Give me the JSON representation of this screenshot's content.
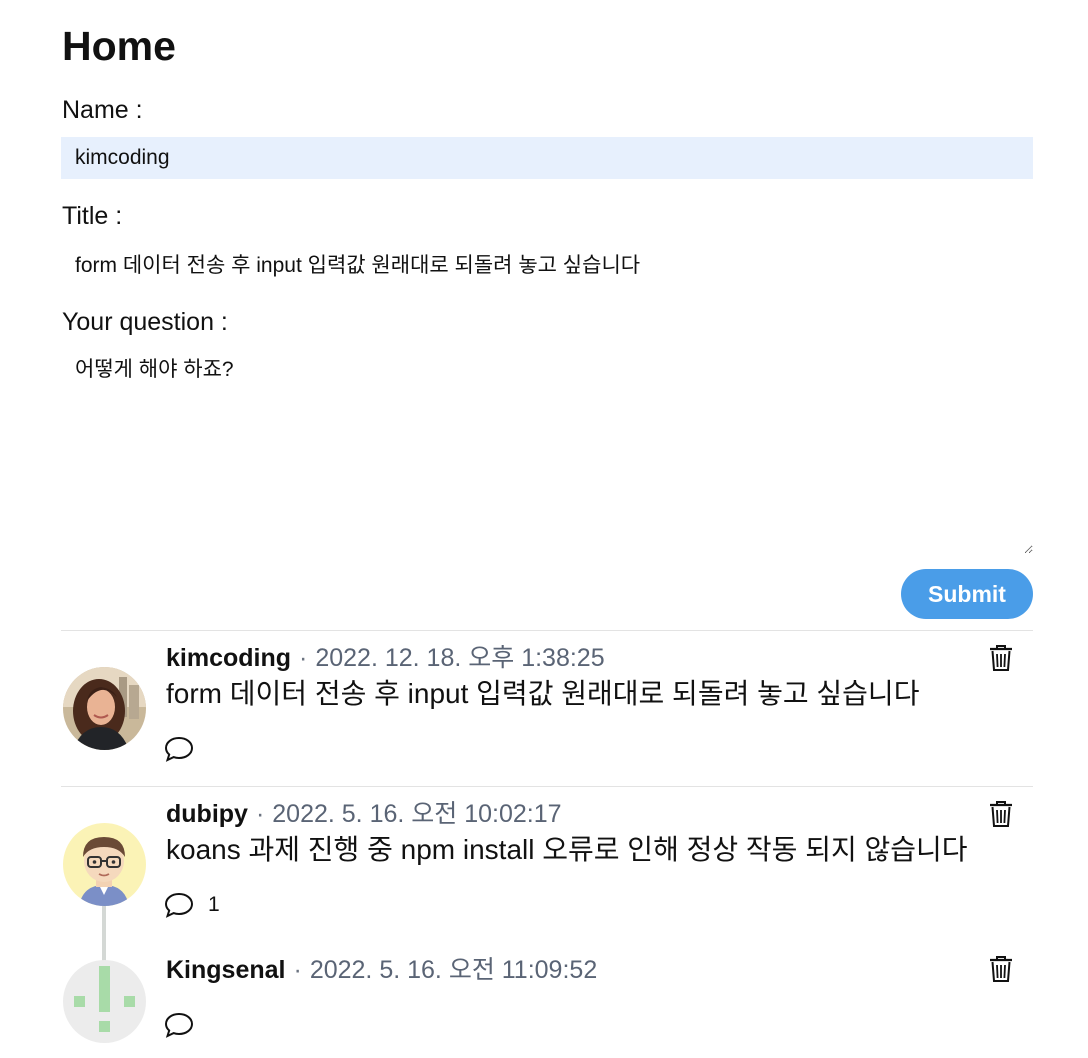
{
  "page": {
    "title": "Home"
  },
  "form": {
    "name_label": "Name :",
    "name_value": "kimcoding",
    "title_label": "Title :",
    "title_value": "form 데이터 전송 후 input 입력값 원래대로 되돌려 놓고 싶습니다",
    "question_label": "Your question :",
    "question_value": "어떻게 해야 하죠?",
    "submit_label": "Submit"
  },
  "discussions": [
    {
      "author": "kimcoding",
      "separator": "·",
      "date": "2022. 12. 18. 오후 1:38:25",
      "body": "form 데이터 전송 후 input 입력값 원래대로 되돌려 놓고 싶습니다",
      "reply_count": "",
      "avatar": "woman-photo-avatar"
    },
    {
      "author": "dubipy",
      "separator": "·",
      "date": "2022. 5. 16. 오전 10:02:17",
      "body": "koans 과제 진행 중 npm install 오류로 인해 정상 작동 되지 않습니다",
      "reply_count": "1",
      "avatar": "cartoon-boy-avatar"
    },
    {
      "author": "Kingsenal",
      "separator": "·",
      "date": "2022. 5. 16. 오전 11:09:52",
      "body": "",
      "reply_count": "",
      "avatar": "identicon-avatar"
    }
  ],
  "colors": {
    "submit": "#4a9de8",
    "name_input_bg": "#e7f0fd",
    "date_text": "#5a6475",
    "identicon": "#a8dba8"
  },
  "icons": {
    "reply": "speech-bubble-icon",
    "delete": "trash-icon"
  }
}
